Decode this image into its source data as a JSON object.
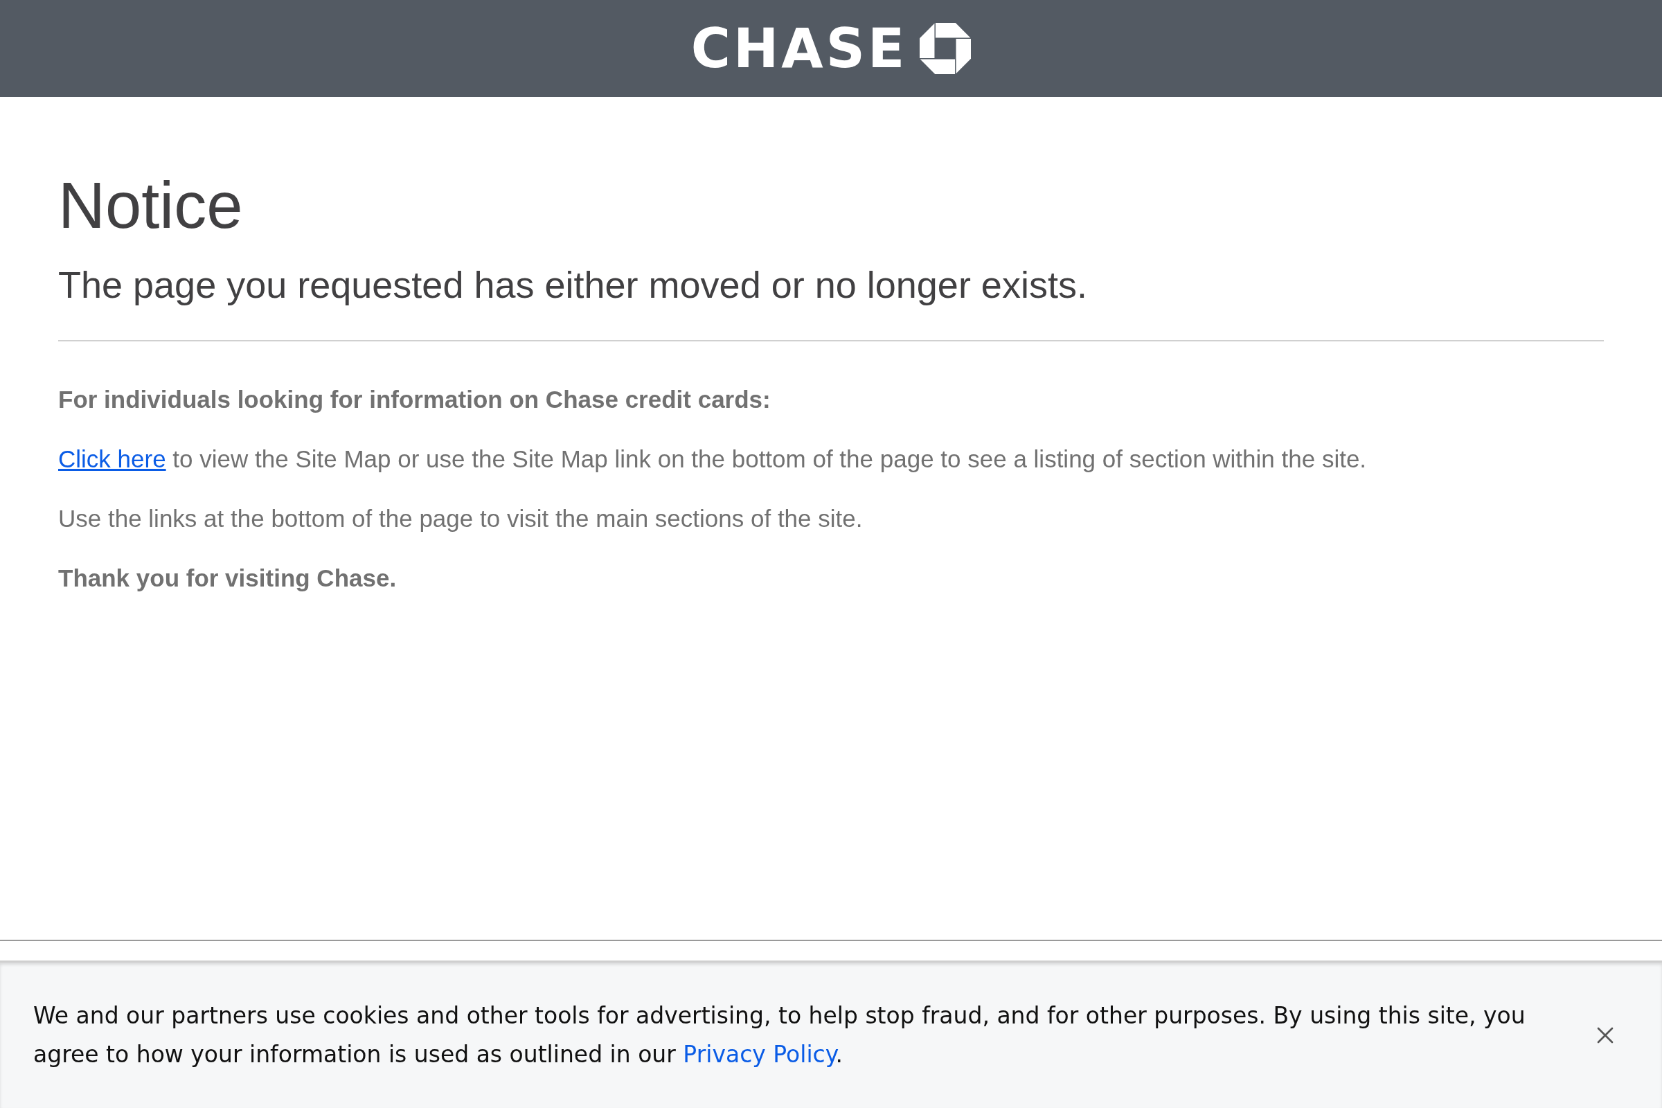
{
  "header": {
    "logo_text": "CHASE"
  },
  "notice": {
    "title": "Notice",
    "subtitle": "The page you requested has either moved or no longer exists."
  },
  "paragraphs": [
    {
      "kind": "bold",
      "text": "For individuals looking for information on Chase credit cards:"
    },
    {
      "kind": "link",
      "link": "Click here",
      "text": "to view the Site Map or use the Site Map link on the bottom of the page to see a listing of section within the site."
    },
    {
      "kind": "plain",
      "text": "Use the links at the bottom of the page to visit the main sections of the site."
    },
    {
      "kind": "bold",
      "text": "Thank you for visiting Chase."
    }
  ],
  "cookie_banner": {
    "text": "We and our partners use cookies and other tools for advertising, to help stop fraud, and for other purposes. By using this site, you agree to how your information is used as outlined in our",
    "link": "Privacy Policy",
    "end": "."
  }
}
